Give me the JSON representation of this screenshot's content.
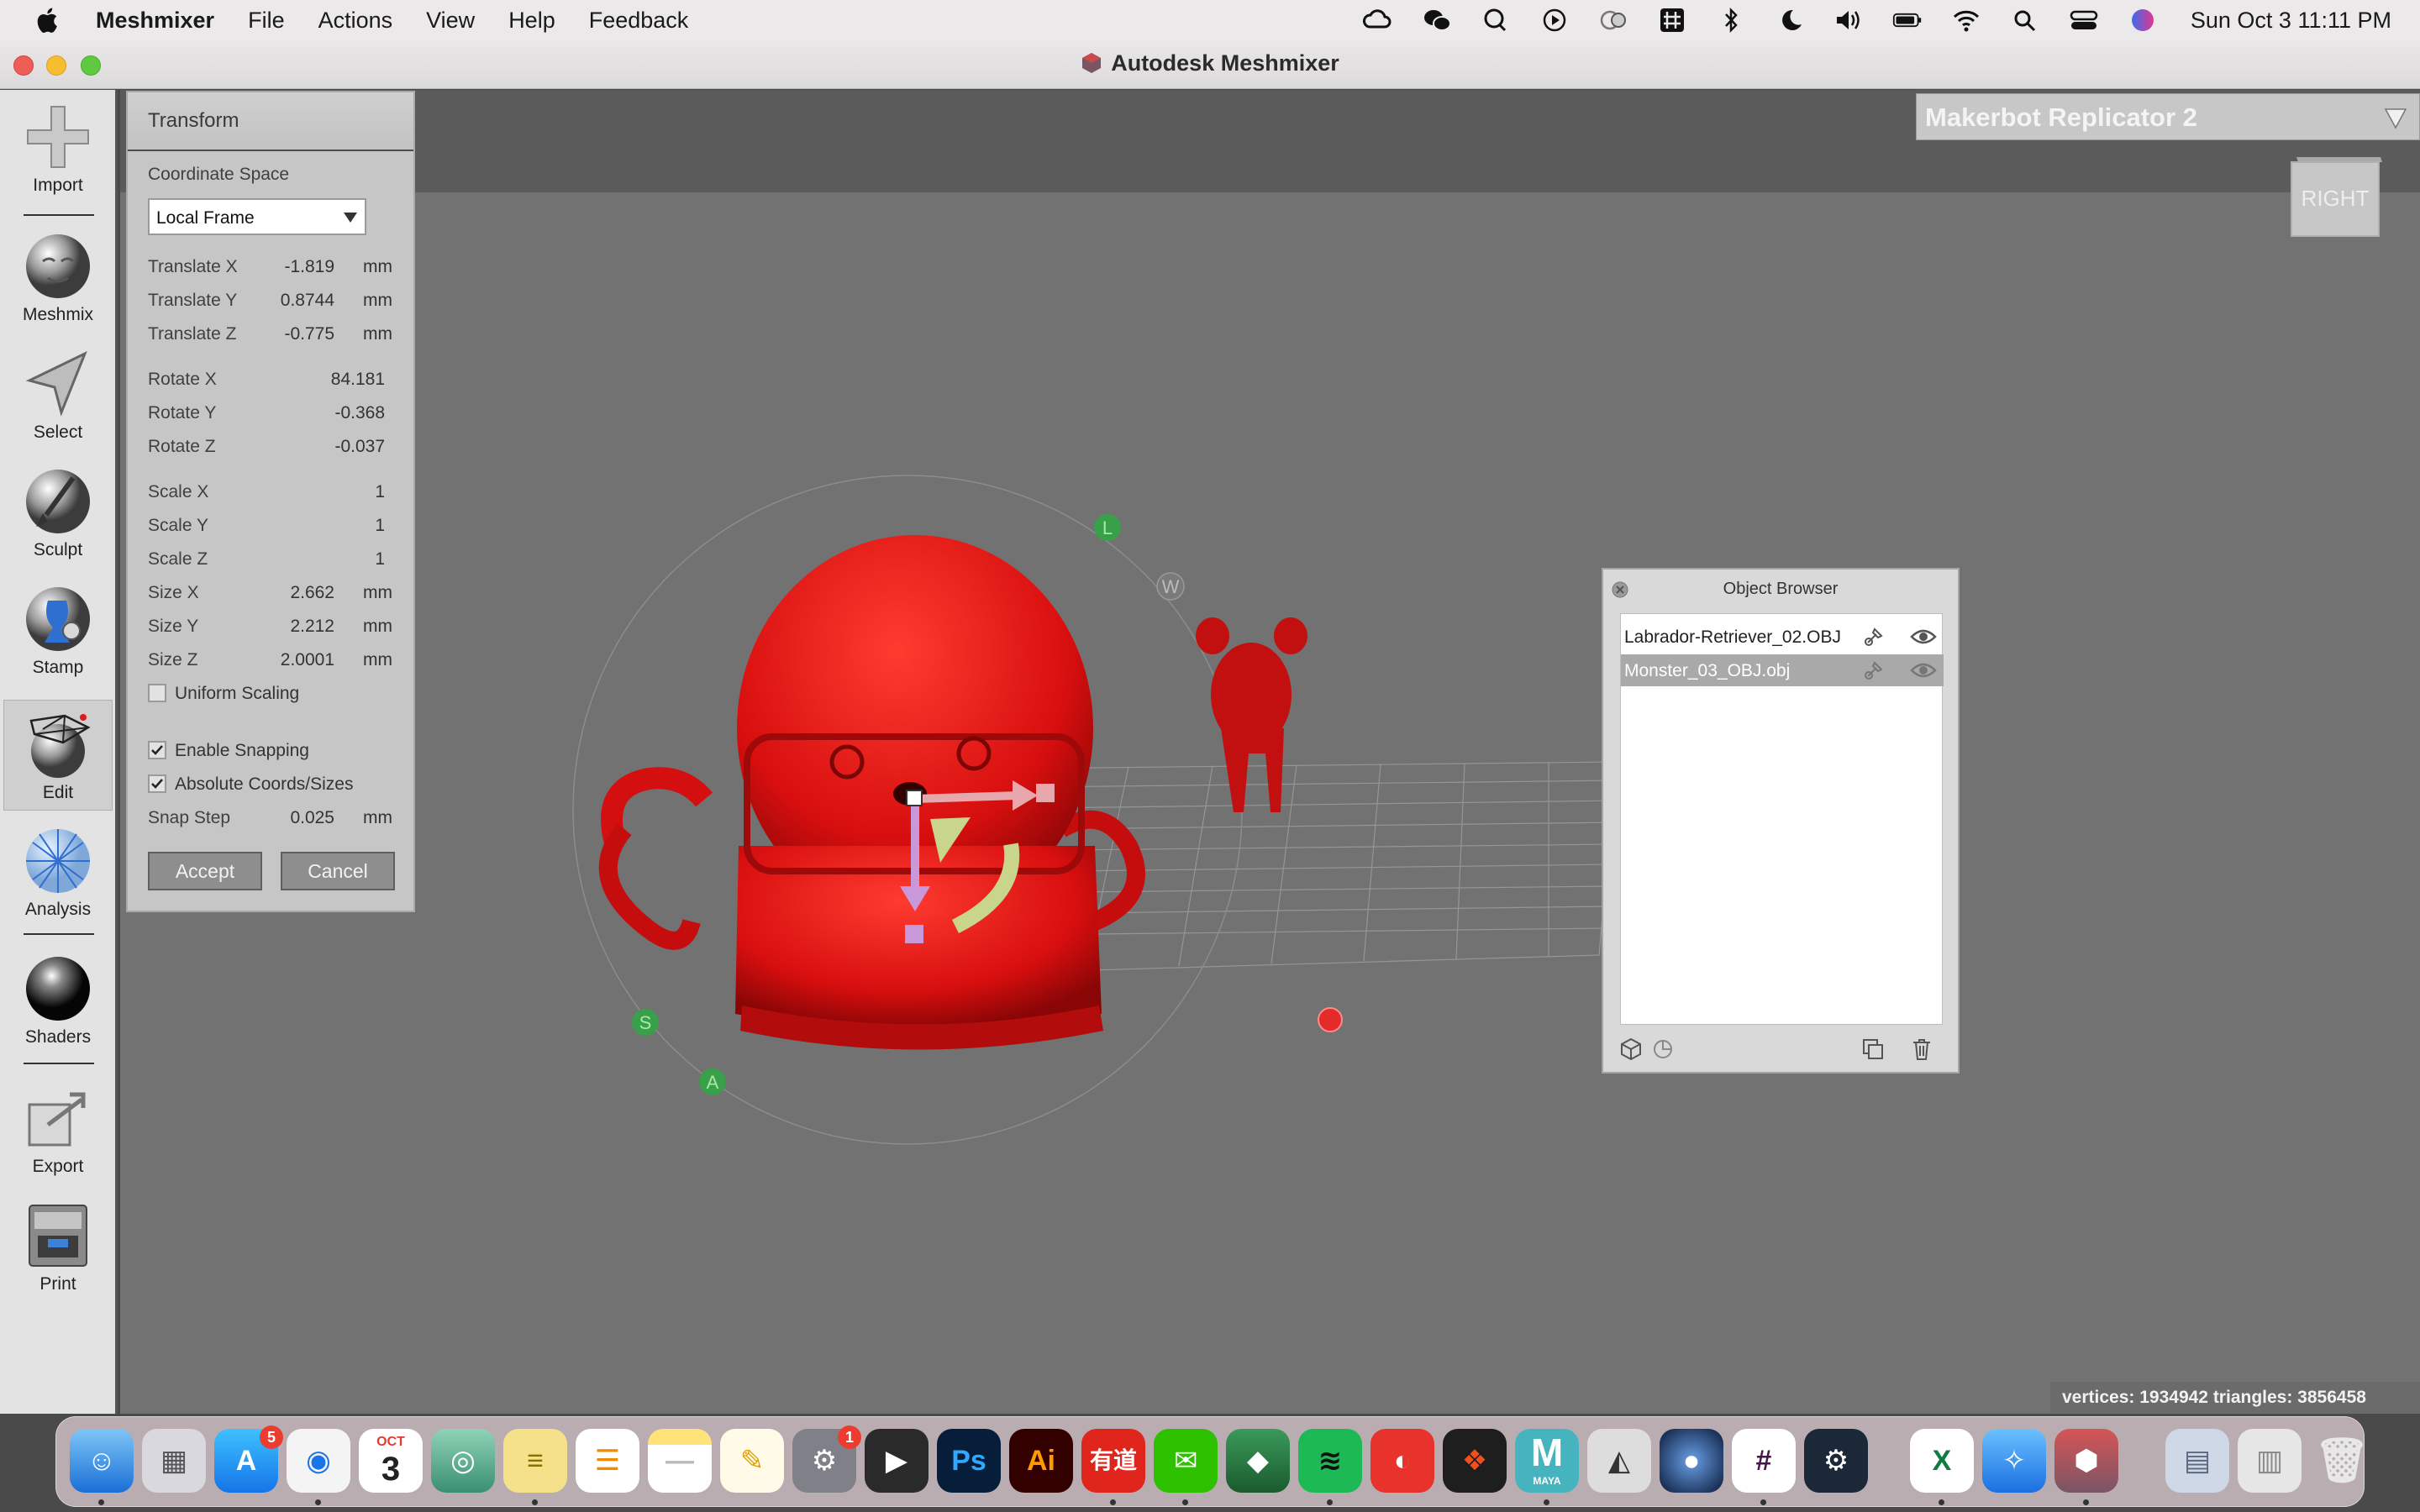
{
  "menubar": {
    "app_name": "Meshmixer",
    "items": [
      "File",
      "Actions",
      "View",
      "Help",
      "Feedback"
    ],
    "clock": "Sun Oct 3  11:11 PM",
    "status_icons": [
      "creative-cloud-icon",
      "wechat-icon",
      "qq-icon",
      "play-icon",
      "cloud-icon",
      "grid-app-icon",
      "bluetooth-icon",
      "moon-icon",
      "volume-icon",
      "battery-icon",
      "wifi-icon",
      "search-icon",
      "control-center-icon",
      "siri-icon"
    ]
  },
  "window": {
    "title": "Autodesk Meshmixer"
  },
  "toolbar": {
    "import": "Import",
    "meshmix": "Meshmix",
    "select": "Select",
    "sculpt": "Sculpt",
    "stamp": "Stamp",
    "edit": "Edit",
    "analysis": "Analysis",
    "shaders": "Shaders",
    "export": "Export",
    "print": "Print"
  },
  "viewport": {
    "printer": "Makerbot Replicator 2",
    "view_cube_label": "RIGHT",
    "stats": "vertices: 1934942 triangles: 3856458",
    "gizmo_labels": {
      "l": "L",
      "w": "W",
      "s": "S",
      "a": "A"
    }
  },
  "transform": {
    "title": "Transform",
    "coordinate_space_label": "Coordinate Space",
    "coordinate_space_value": "Local Frame",
    "fields": {
      "tx": {
        "label": "Translate X",
        "value": "-1.819",
        "unit": "mm"
      },
      "ty": {
        "label": "Translate Y",
        "value": "0.8744",
        "unit": "mm"
      },
      "tz": {
        "label": "Translate Z",
        "value": "-0.775",
        "unit": "mm"
      },
      "rx": {
        "label": "Rotate X",
        "value": "84.181"
      },
      "ry": {
        "label": "Rotate Y",
        "value": "-0.368"
      },
      "rz": {
        "label": "Rotate Z",
        "value": "-0.037"
      },
      "sx": {
        "label": "Scale X",
        "value": "1"
      },
      "sy": {
        "label": "Scale Y",
        "value": "1"
      },
      "sz": {
        "label": "Scale Z",
        "value": "1"
      },
      "zx": {
        "label": "Size X",
        "value": "2.662",
        "unit": "mm"
      },
      "zy": {
        "label": "Size Y",
        "value": "2.212",
        "unit": "mm"
      },
      "zz": {
        "label": "Size Z",
        "value": "2.0001",
        "unit": "mm"
      }
    },
    "uniform_scaling": "Uniform Scaling",
    "enable_snapping": "Enable Snapping",
    "absolute_coords": "Absolute Coords/Sizes",
    "snap_step": {
      "label": "Snap Step",
      "value": "0.025",
      "unit": "mm"
    },
    "accept": "Accept",
    "cancel": "Cancel"
  },
  "object_browser": {
    "title": "Object Browser",
    "objects": [
      {
        "name": "Labrador-Retriever_02.OBJ",
        "selected": false
      },
      {
        "name": "Monster_03_OBJ.obj",
        "selected": true
      }
    ]
  },
  "dock": {
    "calendar_month": "OCT",
    "calendar_day": "3",
    "appstore_badge": "5",
    "settings_badge": "1",
    "youdao_label": "有道",
    "ps_label": "Ps",
    "ai_label": "Ai",
    "maya_label": "M",
    "maya_sub": "MAYA"
  },
  "colors": {
    "model_red": "#e3120f",
    "viewport_bg": "#727272",
    "panel_bg": "#c6c6c6"
  }
}
